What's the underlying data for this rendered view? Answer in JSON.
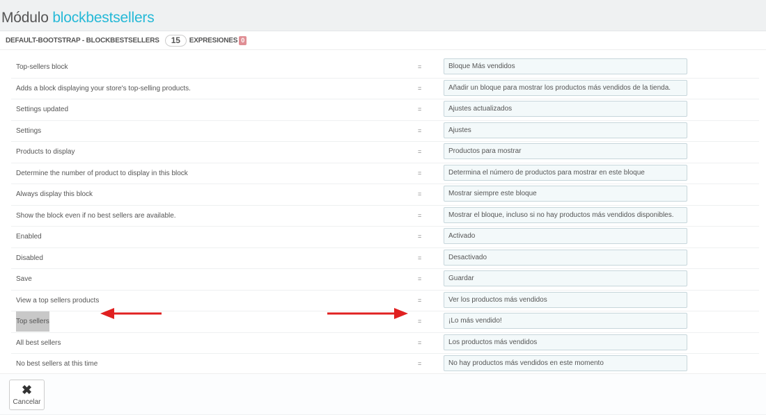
{
  "header": {
    "title_prefix": "Módulo",
    "module_name": "blockbestsellers"
  },
  "panel": {
    "heading": "DEFAULT-BOOTSTRAP - BLOCKBESTSELLERS",
    "count": "15",
    "expressions_label": "EXPRESIONES",
    "missing_count": "0"
  },
  "rows": [
    {
      "source": "Top-sellers block",
      "translation": "Bloque Más vendidos"
    },
    {
      "source": "Adds a block displaying your store's top-selling products.",
      "translation": "Añadir un bloque para mostrar los productos más vendidos de la tienda."
    },
    {
      "source": "Settings updated",
      "translation": "Ajustes actualizados"
    },
    {
      "source": "Settings",
      "translation": "Ajustes"
    },
    {
      "source": "Products to display",
      "translation": "Productos para mostrar"
    },
    {
      "source": "Determine the number of product to display in this block",
      "translation": "Determina el número de productos para mostrar en este bloque"
    },
    {
      "source": "Always display this block",
      "translation": "Mostrar siempre este bloque"
    },
    {
      "source": "Show the block even if no best sellers are available.",
      "translation": "Mostrar el bloque, incluso si no hay productos más vendidos disponibles."
    },
    {
      "source": "Enabled",
      "translation": "Activado"
    },
    {
      "source": "Disabled",
      "translation": "Desactivado"
    },
    {
      "source": "Save",
      "translation": "Guardar"
    },
    {
      "source": "View a top sellers products",
      "translation": "Ver los productos más vendidos"
    },
    {
      "source": "Top sellers",
      "translation": "¡Lo más vendido!"
    },
    {
      "source": "All best sellers",
      "translation": "Los productos más vendidos"
    },
    {
      "source": "No best sellers at this time",
      "translation": "No hay productos más vendidos en este momento"
    }
  ],
  "equals_sign": "=",
  "footer": {
    "cancel_label": "Cancelar"
  },
  "colors": {
    "accent": "#25b9d7",
    "annotation_arrow": "#e02020"
  }
}
